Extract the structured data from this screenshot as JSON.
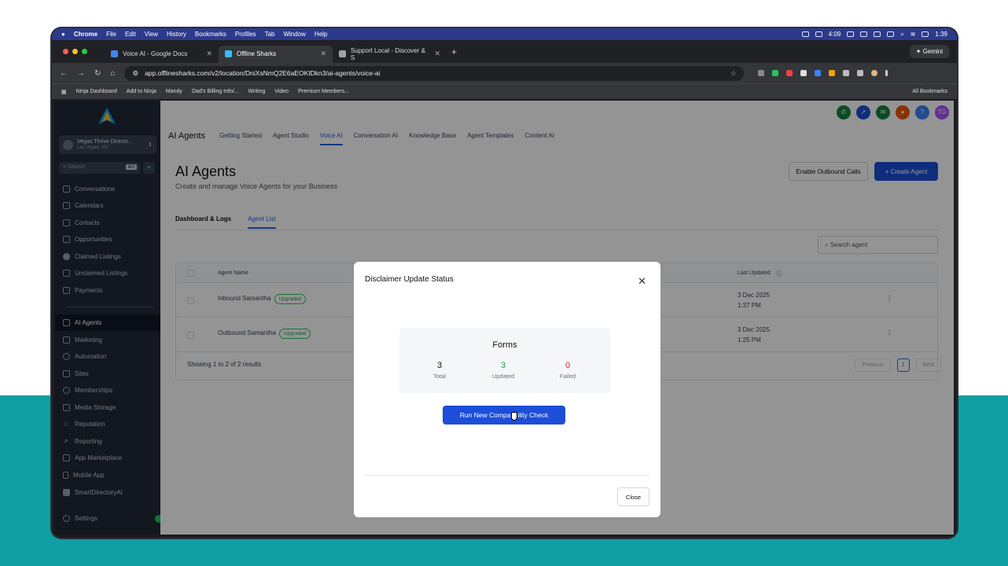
{
  "menubar": {
    "items": [
      "Chrome",
      "File",
      "Edit",
      "View",
      "History",
      "Bookmarks",
      "Profiles",
      "Tab",
      "Window",
      "Help"
    ],
    "timer": "4:09",
    "clock": "1:39"
  },
  "tabs": [
    {
      "title": "Voice AI - Google Docs"
    },
    {
      "title": "Offline Sharks"
    },
    {
      "title": "Support Local - Discover & S"
    }
  ],
  "gemini_label": "Gemini",
  "address": {
    "url": "app.offlinesharks.com/v2/location/DniXsNmQ2E6aEOKIDkn3/ai-agents/voice-ai"
  },
  "bookmarks": {
    "items": [
      "Ninja Dashboard",
      "Add to Ninja",
      "Mandy",
      "Dad's Billing Info/...",
      "Writing",
      "Video",
      "Premium Members..."
    ],
    "all": "All Bookmarks"
  },
  "sidebar": {
    "account_name": "Vegas Thrive Directo...",
    "account_location": "Las Vegas, NV",
    "search_placeholder": "Search",
    "search_shortcut": "⌘K",
    "items": [
      {
        "label": "Conversations"
      },
      {
        "label": "Calendars"
      },
      {
        "label": "Contacts"
      },
      {
        "label": "Opportunities"
      },
      {
        "label": "Claimed Listings"
      },
      {
        "label": "Unclaimed Listings"
      },
      {
        "label": "Payments"
      }
    ],
    "items2": [
      {
        "label": "AI Agents"
      },
      {
        "label": "Marketing"
      },
      {
        "label": "Automation"
      },
      {
        "label": "Sites"
      },
      {
        "label": "Memberships"
      },
      {
        "label": "Media Storage"
      },
      {
        "label": "Reputation"
      },
      {
        "label": "Reporting"
      },
      {
        "label": "App Marketplace"
      },
      {
        "label": "Mobile App"
      },
      {
        "label": "SmartDirectoryAI"
      }
    ],
    "settings": "Settings"
  },
  "topnav": {
    "brand": "AI Agents",
    "items": [
      "Getting Started",
      "Agent Studio",
      "Voice AI",
      "Conversation AI",
      "Knowledge Base",
      "Agent Templates",
      "Content AI"
    ]
  },
  "user_initials": "TG",
  "page": {
    "title": "AI Agents",
    "subtitle": "Create and manage Voice Agents for your Business",
    "enable_outbound": "Enable Outbound Calls",
    "create_agent": "+ Create Agent",
    "subtabs": [
      "Dashboard & Logs",
      "Agent List"
    ],
    "search_placeholder": "Search agent"
  },
  "table": {
    "col_name": "Agent Name",
    "col_updated": "Last Updated",
    "rows": [
      {
        "name": "Inbound Samantha",
        "badge": "Upgraded",
        "date": "3 Dec 2025",
        "time": "1:37 PM"
      },
      {
        "name": "Outbound Samantha",
        "badge": "Upgraded",
        "date": "3 Dec 2025",
        "time": "1:25 PM"
      }
    ],
    "showing": "Showing 1 to 2 of 2 results",
    "prev": "Previous",
    "page": "1",
    "next": "Next"
  },
  "modal": {
    "title": "Disclaimer Update Status",
    "forms_title": "Forms",
    "total_value": "3",
    "total_label": "Total",
    "updated_value": "3",
    "updated_label": "Updated",
    "failed_value": "0",
    "failed_label": "Failed",
    "run_button": "Run New Compatibility Check",
    "close_button": "Close"
  },
  "colors": {
    "accent": "#1d4ed8",
    "success": "#16a34a",
    "danger": "#dc2626",
    "sidebar": "#1f2937"
  }
}
